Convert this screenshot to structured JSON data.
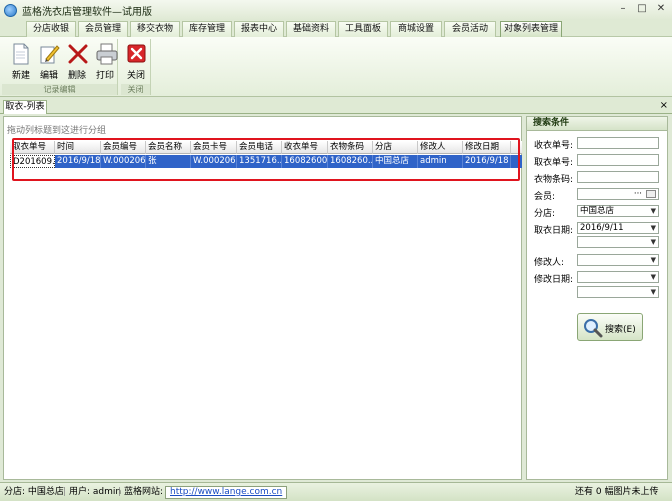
{
  "window": {
    "title": "蓝格洗衣店管理软件—试用版"
  },
  "menu_tabs": [
    "分店收银",
    "会员管理",
    "移交衣物",
    "库存管理",
    "报表中心",
    "基础资料",
    "工具面板",
    "商城设置",
    "会员活动",
    "对象列表管理"
  ],
  "active_menu_tab": "对象列表管理",
  "ribbon": {
    "group1_label": "记录编辑",
    "group2_label": "关闭",
    "buttons": {
      "new": "新建",
      "edit": "编辑",
      "delete": "删除",
      "print": "打印",
      "close": "关闭"
    }
  },
  "doc_tab": {
    "label": "取衣-列表",
    "close": "×"
  },
  "grid": {
    "group_hint": "拖动列标题到这进行分组",
    "columns": [
      "取衣单号",
      "时间",
      "会员编号",
      "会员名称",
      "会员卡号",
      "会员电话",
      "收衣单号",
      "衣物条码",
      "分店",
      "修改人",
      "修改日期"
    ],
    "rows": [
      [
        "D201609...",
        "2016/9/18",
        "W.000206",
        "张",
        "W.000206",
        "1351716...",
        "160826001",
        "1608260...",
        "中国总店",
        "admin",
        "2016/9/18"
      ]
    ]
  },
  "search": {
    "title": "搜索条件",
    "labels": {
      "receive_no": "收衣单号:",
      "pickup_no": "取衣单号:",
      "barcode": "衣物条码:",
      "member": "会员:",
      "branch": "分店:",
      "pickup_date": "取衣日期:",
      "modifier": "修改人:",
      "modify_date": "修改日期:"
    },
    "values": {
      "receive_no": "",
      "pickup_no": "",
      "barcode": "",
      "member": "",
      "branch": "中国总店",
      "pickup_date_from": "2016/9/11",
      "pickup_date_to": "",
      "modifier": "",
      "modify_date_from": "",
      "modify_date_to": ""
    },
    "member_dots": "···",
    "button": "搜索(E)"
  },
  "status": {
    "branch": "分店: 中国总店",
    "user": "用户: admin",
    "site_label": "蓝格网站:",
    "site_url": "http://www.lange.com.cn",
    "right": "还有 0 幅图片未上传"
  }
}
